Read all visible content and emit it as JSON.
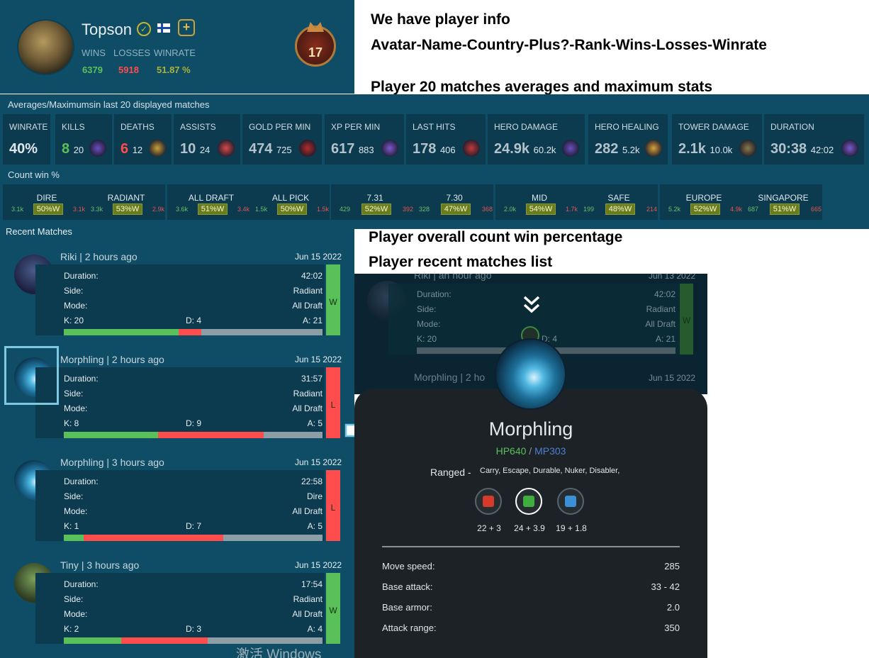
{
  "player": {
    "name": "Topson",
    "wins_label": "WINS",
    "losses_label": "LOSSES",
    "winrate_label": "WINRATE",
    "wins": "6379",
    "losses": "5918",
    "winrate": "51.87 %",
    "rank": "17",
    "icons": [
      "verified-icon",
      "finland-flag-icon",
      "plus-icon",
      "rank-medal-icon"
    ],
    "colors": {
      "wins": "#5ac05a",
      "losses": "#ff4d4d",
      "winrate": "#a9b43a"
    }
  },
  "notes": {
    "n1": "We have player info",
    "n2": "Avatar-Name-Country-Plus?-Rank-Wins-Losses-Winrate",
    "n3": "Player 20 matches averages and maximum stats",
    "n4": "Player overall count win percentage",
    "n5": "Player recent matches list"
  },
  "averages": {
    "title": "Averages/Maximumsin last 20 displayed matches",
    "winrate": {
      "label": "WINRATE",
      "value": "40%"
    },
    "cells": [
      {
        "label": "KILLS",
        "avg": "8",
        "max": "20",
        "color": "#5ac05a"
      },
      {
        "label": "DEATHS",
        "avg": "6",
        "max": "12",
        "color": "#ff4d4d"
      },
      {
        "label": "ASSISTS",
        "avg": "10",
        "max": "24",
        "color": "#b3c3cc"
      },
      {
        "label": "GOLD PER MIN",
        "avg": "474",
        "max": "725",
        "color": "#b3c3cc"
      },
      {
        "label": "XP PER MIN",
        "avg": "617",
        "max": "883",
        "color": "#b3c3cc"
      },
      {
        "label": "LAST HITS",
        "avg": "178",
        "max": "406",
        "color": "#b3c3cc"
      },
      {
        "label": "HERO DAMAGE",
        "avg": "24.9k",
        "max": "60.2k",
        "color": "#b3c3cc"
      },
      {
        "label": "HERO HEALING",
        "avg": "282",
        "max": "5.2k",
        "color": "#b3c3cc"
      },
      {
        "label": "TOWER DAMAGE",
        "avg": "2.1k",
        "max": "10.0k",
        "color": "#b3c3cc"
      },
      {
        "label": "DURATION",
        "avg": "30:38",
        "max": "42:02",
        "color": "#b3c3cc"
      }
    ]
  },
  "count_win": {
    "title": "Count win %",
    "groups": [
      {
        "a": {
          "label": "DIRE",
          "left": "3.1k",
          "pct": "50%W",
          "right": "3.1k"
        },
        "b": {
          "label": "RADIANT",
          "left": "3.3k",
          "pct": "53%W",
          "right": "2.9k"
        }
      },
      {
        "a": {
          "label": "ALL DRAFT",
          "left": "3.6k",
          "pct": "51%W",
          "right": "3.4k"
        },
        "b": {
          "label": "ALL PICK",
          "left": "1.5k",
          "pct": "50%W",
          "right": "1.5k"
        }
      },
      {
        "a": {
          "label": "7.31",
          "left": "429",
          "pct": "52%W",
          "right": "392"
        },
        "b": {
          "label": "7.30",
          "left": "328",
          "pct": "47%W",
          "right": "368"
        }
      },
      {
        "a": {
          "label": "MID",
          "left": "2.0k",
          "pct": "54%W",
          "right": "1.7k"
        },
        "b": {
          "label": "SAFE",
          "left": "199",
          "pct": "48%W",
          "right": "214"
        }
      },
      {
        "a": {
          "label": "EUROPE",
          "left": "5.2k",
          "pct": "52%W",
          "right": "4.9k"
        },
        "b": {
          "label": "SINGAPORE",
          "left": "687",
          "pct": "51%W",
          "right": "665"
        }
      }
    ]
  },
  "recent": {
    "title": "Recent Matches",
    "labels": {
      "duration": "Duration:",
      "side": "Side:",
      "mode": "Mode:"
    },
    "matches": [
      {
        "title": "Riki | 2 hours ago",
        "date": "Jun 15 2022",
        "duration": "42:02",
        "side": "Radiant",
        "mode": "All Draft",
        "k": "K: 20",
        "d": "D: 4",
        "a": "A: 21",
        "result": "W",
        "kills": 20,
        "deaths": 4,
        "assists": 21
      },
      {
        "title": "Morphling | 2 hours ago",
        "date": "Jun 15 2022",
        "duration": "31:57",
        "side": "Radiant",
        "mode": "All Draft",
        "k": "K: 8",
        "d": "D: 9",
        "a": "A: 5",
        "result": "L",
        "kills": 8,
        "deaths": 9,
        "assists": 5
      },
      {
        "title": "Morphling | 3 hours ago",
        "date": "Jun 15 2022",
        "duration": "22:58",
        "side": "Dire",
        "mode": "All Draft",
        "k": "K: 1",
        "d": "D: 7",
        "a": "A: 5",
        "result": "L",
        "kills": 1,
        "deaths": 7,
        "assists": 5
      },
      {
        "title": "Tiny | 3 hours ago",
        "date": "Jun 15 2022",
        "duration": "17:54",
        "side": "Radiant",
        "mode": "All Draft",
        "k": "K: 2",
        "d": "D: 3",
        "a": "A: 4",
        "result": "W",
        "kills": 2,
        "deaths": 3,
        "assists": 4
      }
    ]
  },
  "ghost": {
    "title": "Riki | an hour ago",
    "date": "Jun 13 2022",
    "duration": "42:02",
    "side": "Radiant",
    "mode": "All Draft",
    "k": "K: 20",
    "d": "D: 4",
    "a": "A: 21",
    "result": "W",
    "title2": "Morphling | 2 ho",
    "date2": "Jun 15 2022"
  },
  "hero_card": {
    "name": "Morphling",
    "hp": "HP640",
    "sep": " / ",
    "mp": "MP303",
    "attack_type": "Ranged -",
    "roles": "Carry, Escape, Durable, Nuker, Disabler,",
    "attributes": [
      {
        "value": "22 + 3",
        "icon": "strength-icon"
      },
      {
        "value": "24 + 3.9",
        "icon": "agility-icon"
      },
      {
        "value": "19 + 1.8",
        "icon": "intelligence-icon"
      }
    ],
    "details": [
      {
        "label": "Move speed:",
        "value": "285"
      },
      {
        "label": "Base attack:",
        "value": "33 - 42"
      },
      {
        "label": "Base armor:",
        "value": "2.0"
      },
      {
        "label": "Attack range:",
        "value": "350"
      }
    ]
  },
  "watermark": "激活 Windows"
}
